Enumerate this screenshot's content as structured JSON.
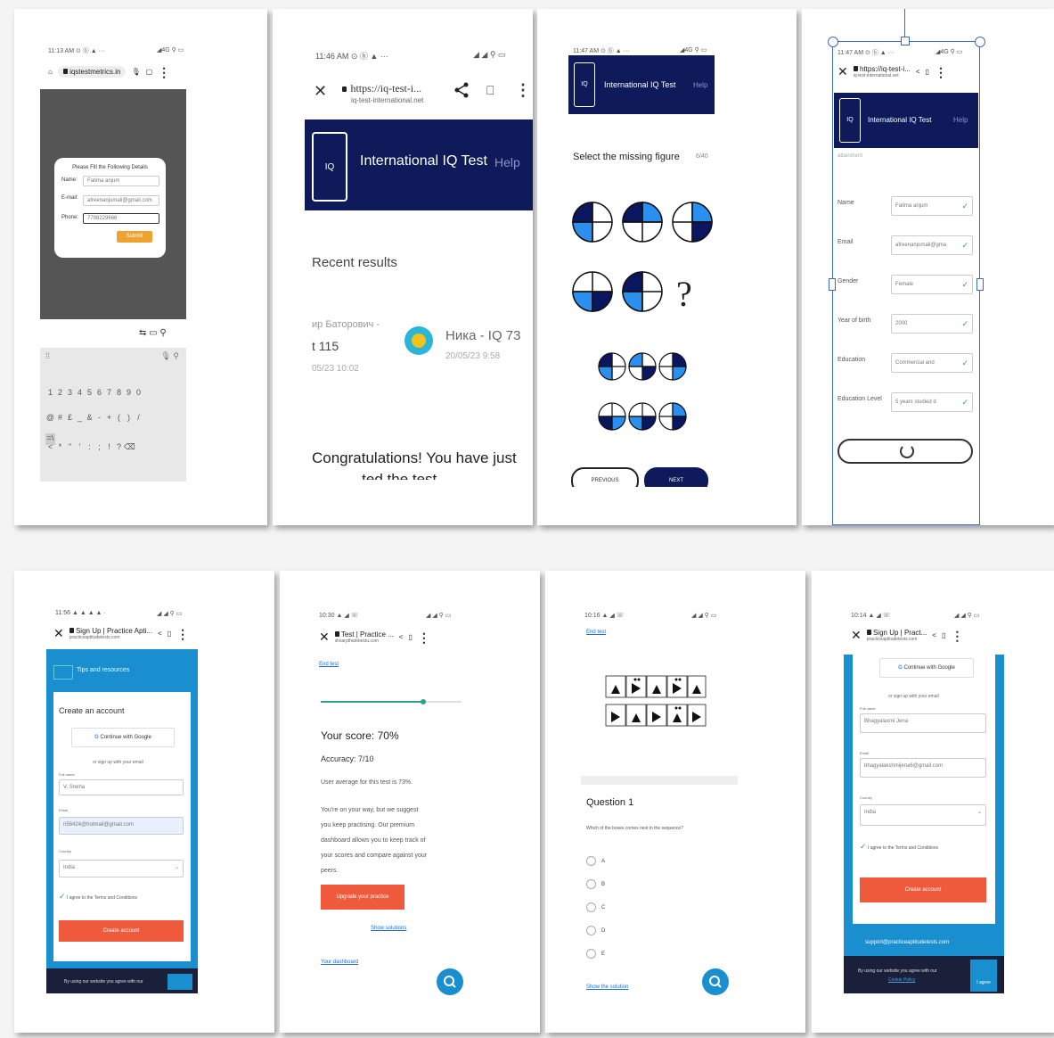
{
  "p1": {
    "status": "11:13 AM ⊙ ⓑ ▲ ···",
    "status_right": "◢4G ⚲ ▭",
    "url": "iqstestmetrics.in",
    "form_title": "Please Fill the Following Details",
    "name_label": "Name:",
    "name_value": "Fatima anjum",
    "email_label": "E-mail:",
    "email_value": "afreenanjumali@gmail.com",
    "phone_label": "Phone:",
    "phone_value": "7798229666",
    "submit_label": "Submit",
    "keys_row1": [
      "1",
      "2",
      "3",
      "4",
      "5",
      "6",
      "7",
      "8",
      "9",
      "0"
    ],
    "keys_row2": [
      "@",
      "#",
      "£",
      "_",
      "&",
      "-",
      "+",
      "(",
      ")",
      "/"
    ],
    "keys_row3": [
      "=\\<",
      "*",
      "\"",
      "'",
      ":",
      ";",
      "!",
      "?",
      "⌫"
    ]
  },
  "p2": {
    "status": "11:46 AM ⊙ ⓑ ▲ ···",
    "status_right": "◢ ◢ ⚲ ▭",
    "url": "https://iq-test-i...",
    "url_sub": "iq-test-international.net",
    "brand": "International IQ Test",
    "help": "Help",
    "recent": "Recent results",
    "left_name": "ир Баторович -",
    "left_score": "t 115",
    "left_date": "05/23 10:02",
    "right_name": "Ника - IQ 73",
    "right_date": "20/05/23 9:58",
    "congrats": "Congratulations! You have just",
    "congrats2": "...ted the test"
  },
  "p3": {
    "status": "11:47 AM ⊙ ⓑ ▲ ···",
    "status_right": "◢4G ⚲ ▭",
    "brand": "International IQ Test",
    "help": "Help",
    "question": "Select the missing figure",
    "counter": "6/40",
    "qmark": "?",
    "prev": "PREVIOUS",
    "next": "NEXT",
    "colors": {
      "navy": "#0b1660",
      "blue": "#2b8ff0"
    }
  },
  "p4": {
    "status": "11:47 AM ⊙ ⓑ ▲ ···",
    "status_right": "◢4G ⚲ ▭",
    "url": "https://iq-test-i...",
    "url_sub": "iq-test-international.net",
    "brand": "International IQ Test",
    "help": "Help",
    "section": "attainment",
    "rows": [
      {
        "label": "Name",
        "value": "Fatima anjum"
      },
      {
        "label": "Email",
        "value": "afreenanjumali@gma"
      },
      {
        "label": "Gender",
        "value": "Female"
      },
      {
        "label": "Year of birth",
        "value": "2000"
      },
      {
        "label": "Education",
        "value": "Commercial and"
      },
      {
        "label": "Education Level",
        "value": "5 years studied d"
      }
    ]
  },
  "p5": {
    "status": "11:56 ▲ ▲ ▲ ▲ ·",
    "status_right": "◢ ◢ ⚲ ▭",
    "url": "Sign Up | Practice Apti...",
    "url_sub": "practiceaptitudetests.com",
    "tips": "Tips and resources",
    "create": "Create an account",
    "google": "Continue with Google",
    "or": "or sign up with your email",
    "fullname_label": "Full name",
    "fullname": "V. Sneha",
    "email_label": "Email",
    "email": "n58424@hotmail@gmail.com",
    "country_label": "Country",
    "country": "India",
    "agree": "I agree to the Terms and Conditions",
    "btn": "Create account",
    "footer": "By using our website you agree with our"
  },
  "p6": {
    "status": "10:30 ▲ ◢ ☏",
    "status_right": "◢ ◢ ⚲ ▭",
    "url": "Test | Practice ...",
    "url_sub": "shsarpthatebestu.com",
    "endtest": "End test",
    "score": "Your score: 70%",
    "accuracy": "Accuracy: 7/10",
    "avg": "User average for this test is 73%.",
    "p1": "You're on your way, but we suggest",
    "p2": "you keep practising. Our premium",
    "p3": "dashboard allows you to keep track of",
    "p4": "your scores and compare against your",
    "p5": "peers.",
    "upgrade": "Upgrade your practice",
    "solutions": "Show solutions",
    "dashboard": "Your dashboard"
  },
  "p7": {
    "status": "10:16 ▲ ◢ ☏",
    "status_right": "◢ ◢ ⚲ ▭",
    "endtest": "End test",
    "question": "Question 1",
    "prompt": "Which of the boxes comes next in the sequence?",
    "options": [
      "A",
      "B",
      "C",
      "D",
      "E"
    ],
    "solution": "Show the solution"
  },
  "p8": {
    "status": "10:14 ▲ ◢ ☏",
    "status_right": "◢ ◢ ⚲ ▭",
    "url": "Sign Up | Pract...",
    "url_sub": "practiceaptitudetests.com",
    "google": "Continue with Google",
    "or": "or sign up with your email",
    "fullname_label": "Full name",
    "fullname": "Bhagyalaxmi Jena",
    "email_label": "Email",
    "email": "bhagyalakshmijena6@gmail.com",
    "country_label": "Country",
    "country": "India",
    "agree": "I agree to the Terms and Conditions",
    "btn": "Create account",
    "support": "support@practiceaptitudetests.com",
    "footer": "By using our website you agree with our",
    "footer2": "Cookie Policy",
    "agree_btn": "I agree"
  }
}
